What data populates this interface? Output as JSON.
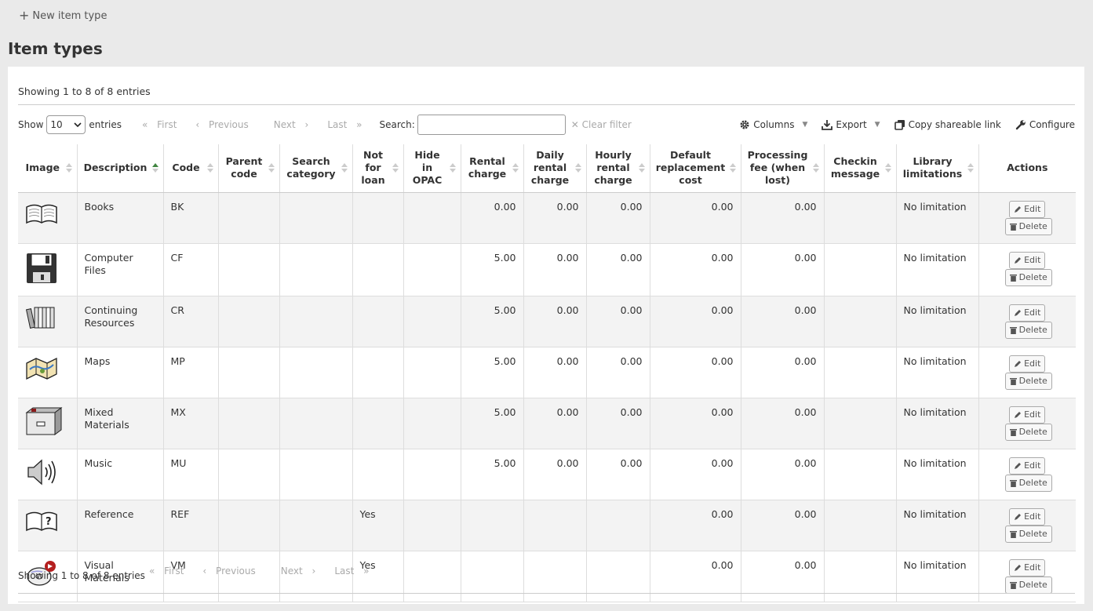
{
  "toolbar": {
    "new_item_type": "New item type"
  },
  "page_title": "Item types",
  "table_info_top": "Showing 1 to 8 of 8 entries",
  "table_info_bottom": "Showing 1 to 8 of 8 entries",
  "length_control": {
    "show_label": "Show",
    "value": "10",
    "entries_label": "entries"
  },
  "pager": {
    "first": "First",
    "previous": "Previous",
    "next": "Next",
    "last": "Last"
  },
  "search": {
    "label": "Search:",
    "value": "",
    "clear_filter": "Clear filter"
  },
  "tools": {
    "columns": "Columns",
    "export": "Export",
    "copy_link": "Copy shareable link",
    "configure": "Configure"
  },
  "columns": [
    "Image",
    "Description",
    "Code",
    "Parent code",
    "Search category",
    "Not for loan",
    "Hide in OPAC",
    "Rental charge",
    "Daily rental charge",
    "Hourly rental charge",
    "Default replacement cost",
    "Processing fee (when lost)",
    "Checkin message",
    "Library limitations",
    "Actions"
  ],
  "actions": {
    "edit": "Edit",
    "delete": "Delete"
  },
  "rows": [
    {
      "icon": "book-icon",
      "description": "Books",
      "code": "BK",
      "parent_code": "",
      "search_category": "",
      "not_for_loan": "",
      "hide_in_opac": "",
      "rental_charge": "0.00",
      "daily_rental": "0.00",
      "hourly_rental": "0.00",
      "replacement_cost": "0.00",
      "processing_fee": "0.00",
      "checkin_message": "",
      "library_limitations": "No limitation"
    },
    {
      "icon": "floppy-disk-icon",
      "description": "Computer Files",
      "code": "CF",
      "parent_code": "",
      "search_category": "",
      "not_for_loan": "",
      "hide_in_opac": "",
      "rental_charge": "5.00",
      "daily_rental": "0.00",
      "hourly_rental": "0.00",
      "replacement_cost": "0.00",
      "processing_fee": "0.00",
      "checkin_message": "",
      "library_limitations": "No limitation"
    },
    {
      "icon": "periodicals-icon",
      "description": "Continuing Resources",
      "code": "CR",
      "parent_code": "",
      "search_category": "",
      "not_for_loan": "",
      "hide_in_opac": "",
      "rental_charge": "5.00",
      "daily_rental": "0.00",
      "hourly_rental": "0.00",
      "replacement_cost": "0.00",
      "processing_fee": "0.00",
      "checkin_message": "",
      "library_limitations": "No limitation"
    },
    {
      "icon": "map-icon",
      "description": "Maps",
      "code": "MP",
      "parent_code": "",
      "search_category": "",
      "not_for_loan": "",
      "hide_in_opac": "",
      "rental_charge": "5.00",
      "daily_rental": "0.00",
      "hourly_rental": "0.00",
      "replacement_cost": "0.00",
      "processing_fee": "0.00",
      "checkin_message": "",
      "library_limitations": "No limitation"
    },
    {
      "icon": "box-icon",
      "description": "Mixed Materials",
      "code": "MX",
      "parent_code": "",
      "search_category": "",
      "not_for_loan": "",
      "hide_in_opac": "",
      "rental_charge": "5.00",
      "daily_rental": "0.00",
      "hourly_rental": "0.00",
      "replacement_cost": "0.00",
      "processing_fee": "0.00",
      "checkin_message": "",
      "library_limitations": "No limitation"
    },
    {
      "icon": "speaker-icon",
      "description": "Music",
      "code": "MU",
      "parent_code": "",
      "search_category": "",
      "not_for_loan": "",
      "hide_in_opac": "",
      "rental_charge": "5.00",
      "daily_rental": "0.00",
      "hourly_rental": "0.00",
      "replacement_cost": "0.00",
      "processing_fee": "0.00",
      "checkin_message": "",
      "library_limitations": "No limitation"
    },
    {
      "icon": "reference-book-icon",
      "description": "Reference",
      "code": "REF",
      "parent_code": "",
      "search_category": "",
      "not_for_loan": "Yes",
      "hide_in_opac": "",
      "rental_charge": "",
      "daily_rental": "",
      "hourly_rental": "",
      "replacement_cost": "0.00",
      "processing_fee": "0.00",
      "checkin_message": "",
      "library_limitations": "No limitation"
    },
    {
      "icon": "disc-icon",
      "description": "Visual Materials",
      "code": "VM",
      "parent_code": "",
      "search_category": "",
      "not_for_loan": "Yes",
      "hide_in_opac": "",
      "rental_charge": "",
      "daily_rental": "",
      "hourly_rental": "",
      "replacement_cost": "0.00",
      "processing_fee": "0.00",
      "checkin_message": "",
      "library_limitations": "No limitation"
    }
  ]
}
